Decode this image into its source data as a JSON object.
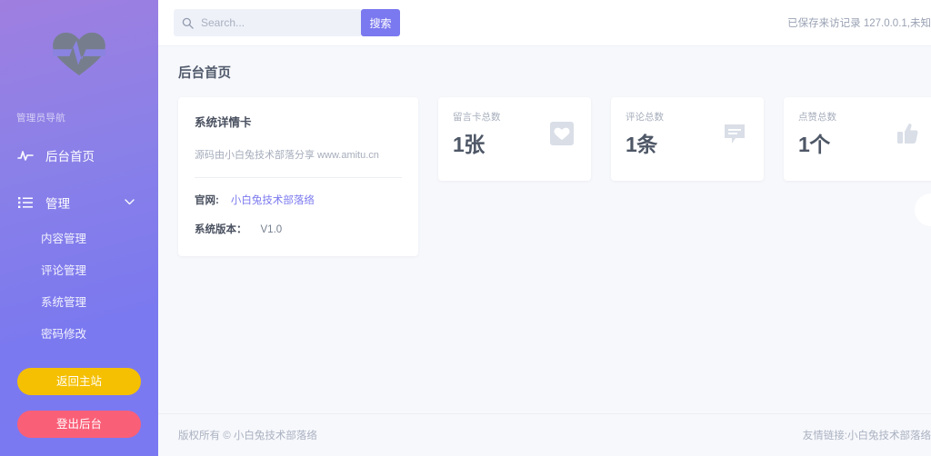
{
  "sidebar": {
    "logo_icon": "heartbeat-pulse-icon",
    "nav_title": "管理员导航",
    "items": [
      {
        "label": "后台首页",
        "icon": "activity-pulse-icon"
      },
      {
        "label": "管理",
        "icon": "list-menu-icon",
        "chevron": "⌄"
      }
    ],
    "sub_items": [
      {
        "label": "内容管理"
      },
      {
        "label": "评论管理"
      },
      {
        "label": "系统管理"
      },
      {
        "label": "密码修改"
      }
    ],
    "home_button": "返回主站",
    "logout_button": "登出后台",
    "colors": {
      "gradient_top": "#9f7fe0",
      "gradient_bottom": "#7b79f2",
      "home_button": "#f5c002",
      "logout_button": "#fa5f78"
    }
  },
  "topbar": {
    "search_placeholder": "Search...",
    "search_value": "",
    "search_button": "搜索",
    "search_icon": "search-icon",
    "visit_note": "已保存来访记录 127.0.0.1,未知"
  },
  "main": {
    "page_title": "后台首页",
    "detail_card": {
      "title": "系统详情卡",
      "subtitle": "源码由小白兔技术部落分享 www.amitu.cn",
      "rows": [
        {
          "label": "官网:",
          "link": "小白兔技术部落络"
        },
        {
          "label": "系统版本：",
          "value": "V1.0"
        }
      ]
    },
    "stats": [
      {
        "label": "留言卡总数",
        "value": "1张",
        "icon": "heart-icon"
      },
      {
        "label": "评论总数",
        "value": "1条",
        "icon": "comment-icon"
      },
      {
        "label": "点赞总数",
        "value": "1个",
        "icon": "thumbs-up-icon"
      }
    ]
  },
  "footer": {
    "copyright": "版权所有 © 小白兔技术部落络",
    "links": "友情链接:小白兔技术部落络"
  },
  "theme": {
    "accent": "#7b79ef",
    "content_bg": "#f7f8fc",
    "card_bg": "#ffffff",
    "icon_gray": "#d5dae4"
  }
}
